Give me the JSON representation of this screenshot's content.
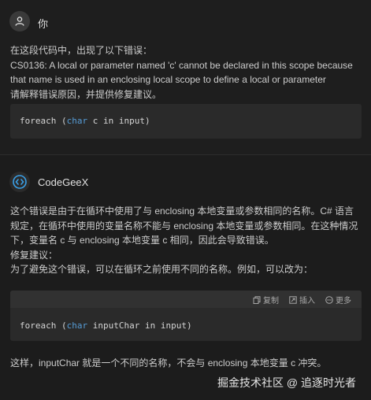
{
  "user": {
    "name": "你",
    "lines": [
      "在这段代码中，出现了以下错误：",
      "CS0136: A local or parameter named 'c' cannot be declared in this scope because",
      "that name is used in an enclosing local scope to define a local or parameter",
      "请解释错误原因，并提供修复建议。"
    ],
    "code": {
      "keyword": "foreach",
      "open": " (",
      "type": "char",
      "rest": " c in input)"
    }
  },
  "assistant": {
    "name": "CodeGeeX",
    "lines": [
      "这个错误是由于在循环中使用了与 enclosing 本地变量或参数相同的名称。C# 语言",
      "规定，在循环中使用的变量名称不能与 enclosing 本地变量或参数相同。在这种情况",
      "下，变量名 c 与 enclosing 本地变量 c 相同，因此会导致错误。",
      "修复建议：",
      "为了避免这个错误，可以在循环之前使用不同的名称。例如，可以改为："
    ],
    "code_toolbar": {
      "copy": "复制",
      "insert": "插入",
      "more": "更多"
    },
    "code": {
      "keyword": "foreach",
      "open": " (",
      "type": "char",
      "rest": " inputChar in input)"
    },
    "after": "这样，inputChar 就是一个不同的名称，不会与 enclosing 本地变量 c 冲突。"
  },
  "watermark": "掘金技术社区 @ 追逐时光者",
  "colors": {
    "background": "#1e1e1e",
    "text": "#cccccc",
    "keyword": "#569cd6",
    "code_bg": "#2a2a2a"
  }
}
